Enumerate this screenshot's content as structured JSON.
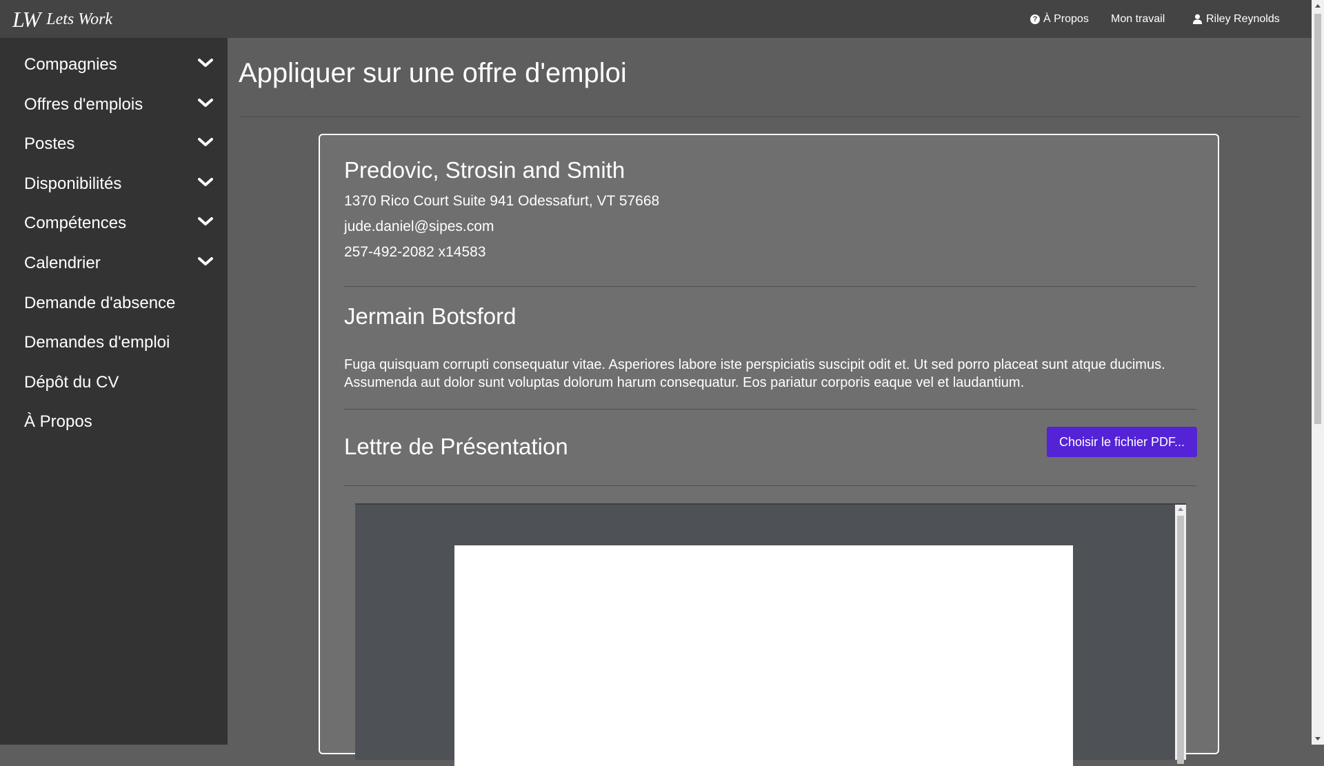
{
  "navbar": {
    "brand_logo": "LW",
    "brand_name": "Lets Work",
    "about": "À Propos",
    "my_work": "Mon travail",
    "user_name": "Riley Reynolds"
  },
  "sidebar": {
    "items": [
      {
        "label": "Compagnies",
        "has_chevron": true
      },
      {
        "label": "Offres d'emplois",
        "has_chevron": true
      },
      {
        "label": "Postes",
        "has_chevron": true
      },
      {
        "label": "Disponibilités",
        "has_chevron": true
      },
      {
        "label": "Compétences",
        "has_chevron": true
      },
      {
        "label": "Calendrier",
        "has_chevron": true
      },
      {
        "label": "Demande d'absence",
        "has_chevron": false
      },
      {
        "label": "Demandes d'emploi",
        "has_chevron": false
      },
      {
        "label": "Dépôt du CV",
        "has_chevron": false
      },
      {
        "label": "À Propos",
        "has_chevron": false
      }
    ]
  },
  "main": {
    "page_title": "Appliquer sur une offre d'emploi",
    "company": {
      "name": "Predovic, Strosin and Smith",
      "address": "1370 Rico Court Suite 941 Odessafurt, VT 57668",
      "email": "jude.daniel@sipes.com",
      "phone": "257-492-2082 x14583"
    },
    "job": {
      "title": "Jermain Botsford",
      "description": "Fuga quisquam corrupti consequatur vitae. Asperiores labore iste perspiciatis suscipit odit et. Ut sed porro placeat sunt atque ducimus. Assumenda aut dolor sunt voluptas dolorum harum consequatur. Eos pariatur corporis eaque vel et laudantium."
    },
    "cover_letter": {
      "title": "Lettre de Présentation",
      "choose_pdf_button": "Choisir le fichier PDF..."
    }
  },
  "colors": {
    "topbar": "#444444",
    "sidebar": "#333333",
    "content_bg": "#5e5e5e",
    "card_bg": "#6f6f6f",
    "primary_button": "#5423d6",
    "pdf_viewer_bg": "#4e5155"
  },
  "icons": {
    "about": "question-circle-icon",
    "user": "user-icon",
    "chevron": "chevron-down-icon"
  }
}
